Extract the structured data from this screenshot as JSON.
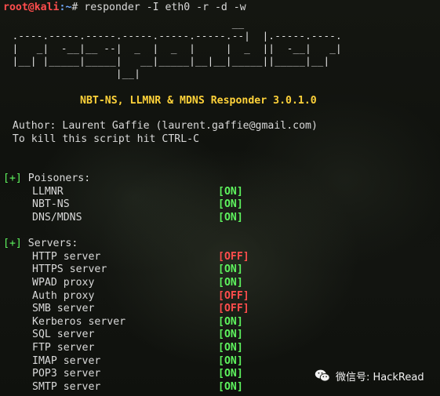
{
  "terminal": {
    "prompt_user": "root@kali",
    "prompt_path": ":~",
    "prompt_symbol": "#",
    "command": " responder -I eth0 -r -d -w",
    "banner": [
      "                                      __",
      "  .----.-----.-----.-----.-----.-----.--|  |.-----.----.",
      "  |   _|  -__|__ --|  _  |  _  |     |  _  ||  -__|   _|",
      "  |__| |_____|_____|   __|_____|__|__|_____||_____|__|",
      "                   |__|"
    ],
    "title": "NBT-NS, LLMNR & MDNS Responder 3.0.1.0",
    "author_line": "  Author: Laurent Gaffie (laurent.gaffie@gmail.com)",
    "kill_line": "  To kill this script hit CTRL-C",
    "sections": [
      {
        "marker": "[+]",
        "label": " Poisoners:",
        "items": [
          {
            "name": "LLMNR",
            "status": "[ON]",
            "state": "on"
          },
          {
            "name": "NBT-NS",
            "status": "[ON]",
            "state": "on"
          },
          {
            "name": "DNS/MDNS",
            "status": "[ON]",
            "state": "on"
          }
        ]
      },
      {
        "marker": "[+]",
        "label": " Servers:",
        "items": [
          {
            "name": "HTTP server",
            "status": "[OFF]",
            "state": "off"
          },
          {
            "name": "HTTPS server",
            "status": "[ON]",
            "state": "on"
          },
          {
            "name": "WPAD proxy",
            "status": "[ON]",
            "state": "on"
          },
          {
            "name": "Auth proxy",
            "status": "[OFF]",
            "state": "off"
          },
          {
            "name": "SMB server",
            "status": "[OFF]",
            "state": "off"
          },
          {
            "name": "Kerberos server",
            "status": "[ON]",
            "state": "on"
          },
          {
            "name": "SQL server",
            "status": "[ON]",
            "state": "on"
          },
          {
            "name": "FTP server",
            "status": "[ON]",
            "state": "on"
          },
          {
            "name": "IMAP server",
            "status": "[ON]",
            "state": "on"
          },
          {
            "name": "POP3 server",
            "status": "[ON]",
            "state": "on"
          },
          {
            "name": "SMTP server",
            "status": "[ON]",
            "state": "on"
          }
        ]
      }
    ]
  },
  "watermark": {
    "text": "微信号: HackRead",
    "icon": "wechat-icon"
  },
  "colors": {
    "on": "#5ef35e",
    "off": "#ff4d4d",
    "title": "#ffd23a",
    "prompt_user": "#ff4d4d",
    "prompt_path": "#6fa8ff"
  }
}
